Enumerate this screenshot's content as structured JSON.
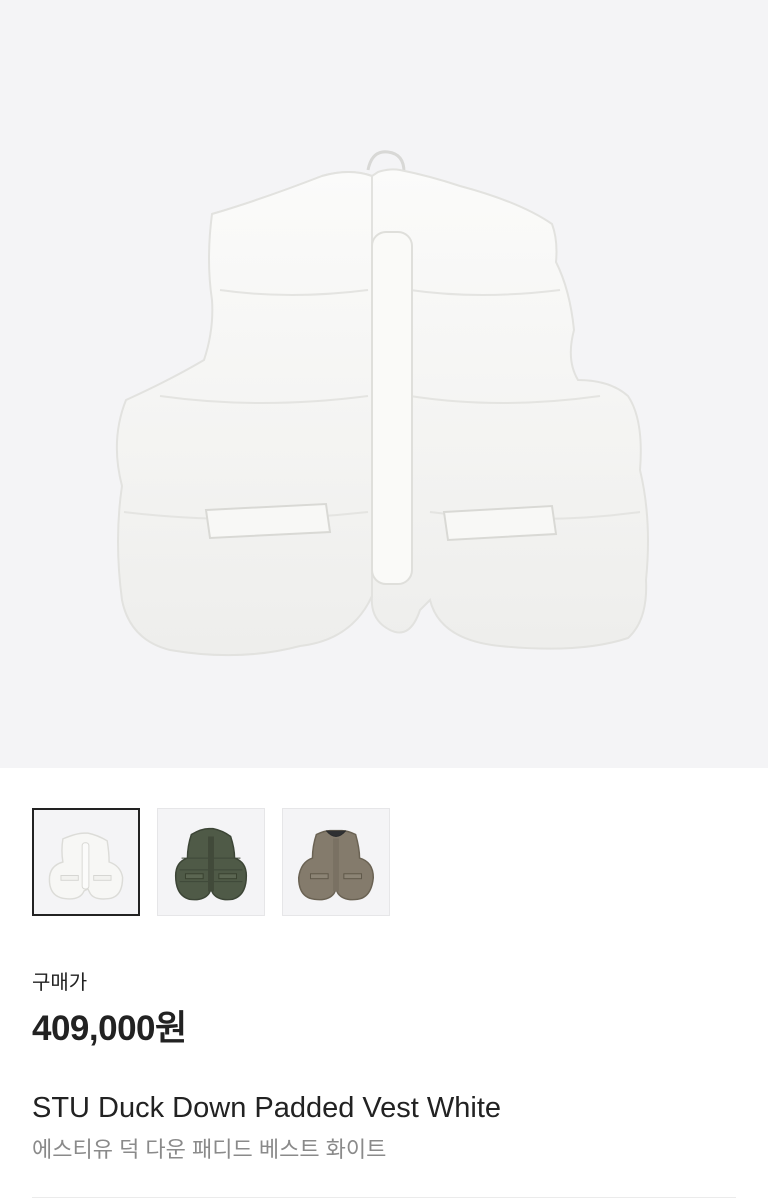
{
  "product": {
    "image": {
      "main_icon": "vest-photo",
      "main_color": "#f7f7f5",
      "background": "#f4f4f6"
    },
    "thumbnails": [
      {
        "icon": "vest-white-thumb",
        "color": "#f7f7f5",
        "selected": true
      },
      {
        "icon": "vest-green-thumb",
        "color": "#4f5a47",
        "selected": false
      },
      {
        "icon": "vest-khaki-thumb",
        "color": "#847b6c",
        "selected": false
      }
    ],
    "price_label": "구매가",
    "price": "409,000원",
    "name_en": "STU Duck Down Padded Vest White",
    "name_ko": "에스티유 덕 다운 패디드 베스트 화이트"
  }
}
